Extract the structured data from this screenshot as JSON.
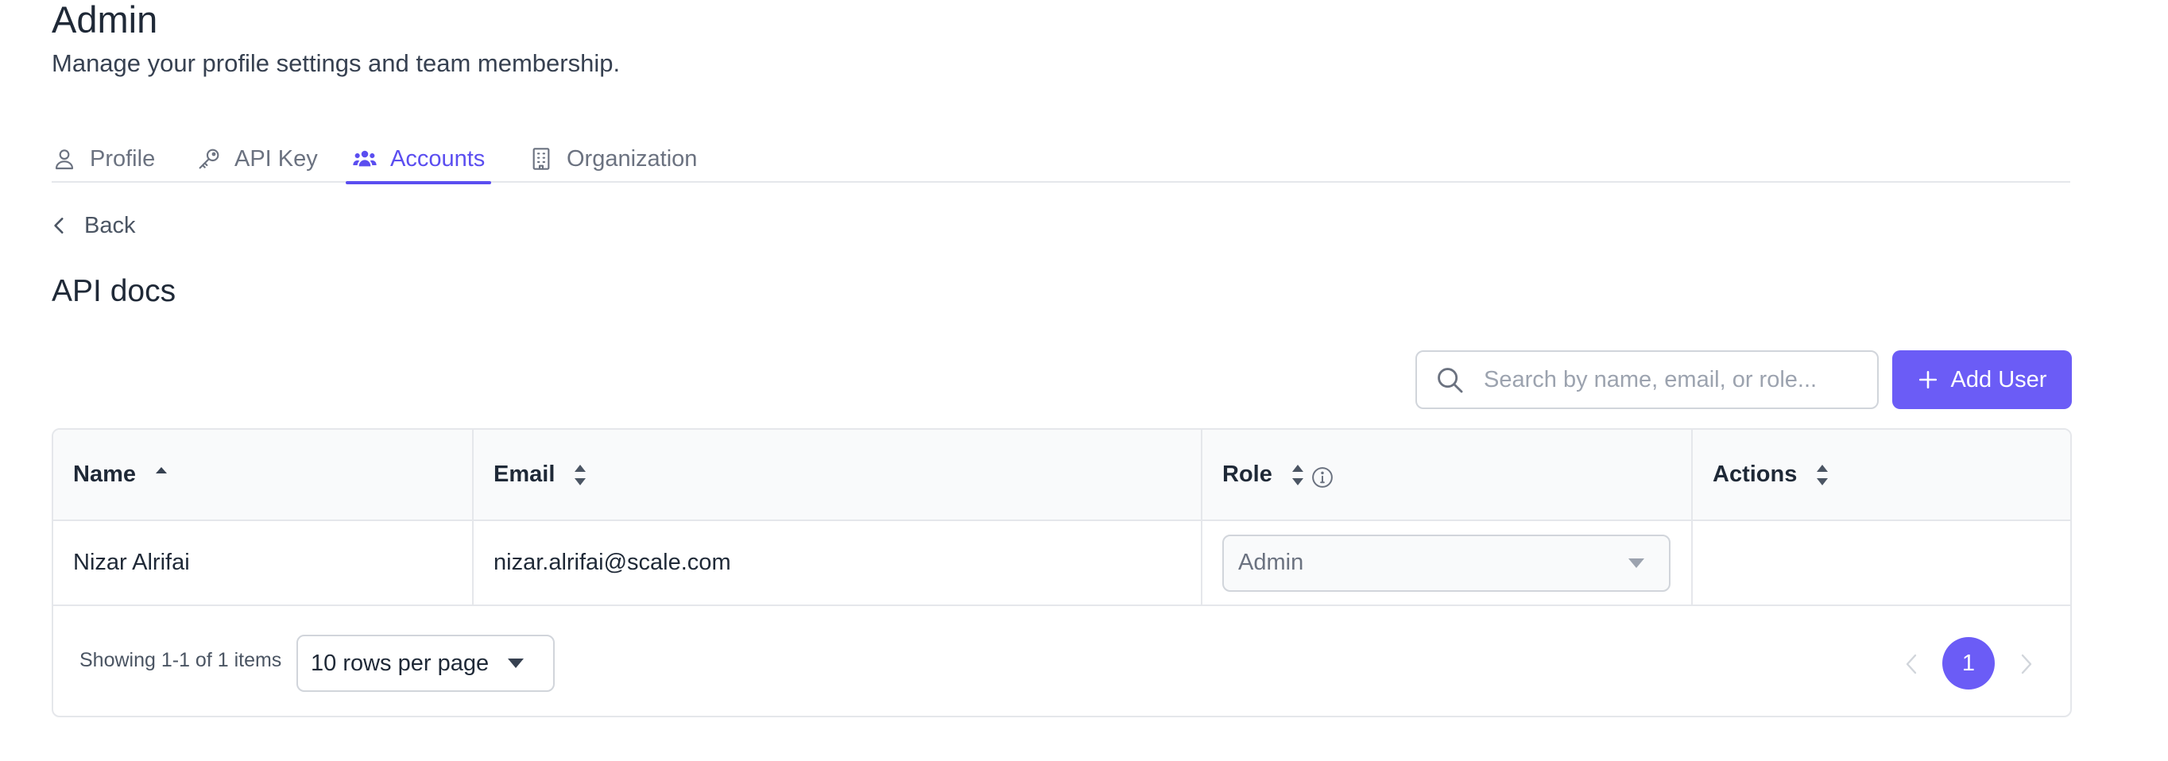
{
  "header": {
    "title": "Admin",
    "subtitle": "Manage your profile settings and team membership."
  },
  "tabs": [
    {
      "label": "Profile",
      "icon": "user-icon",
      "active": false
    },
    {
      "label": "API Key",
      "icon": "key-icon",
      "active": false
    },
    {
      "label": "Accounts",
      "icon": "users-icon",
      "active": true
    },
    {
      "label": "Organization",
      "icon": "building-icon",
      "active": false
    }
  ],
  "back": {
    "label": "Back",
    "icon": "chevron-left-icon"
  },
  "section": {
    "title": "API docs"
  },
  "toolbar": {
    "search_placeholder": "Search by name, email, or role...",
    "search_value": "",
    "add_user_label": "Add User"
  },
  "table": {
    "columns": [
      {
        "label": "Name",
        "sort": "ascending"
      },
      {
        "label": "Email",
        "sort": "none"
      },
      {
        "label": "Role",
        "sort": "none",
        "info": true
      },
      {
        "label": "Actions",
        "sort": "none"
      }
    ],
    "rows": [
      {
        "name": "Nizar Alrifai",
        "email": "nizar.alrifai@scale.com",
        "role": "Admin",
        "actions": ""
      }
    ]
  },
  "footer": {
    "showing": "Showing 1-1 of 1 items",
    "rows_per_page": "10 rows per page",
    "current_page": "1"
  },
  "colors": {
    "accent": "#6b5cf6",
    "tab_active": "#5b4ef0",
    "border": "#e5e7eb",
    "header_bg": "#f9fafb"
  }
}
